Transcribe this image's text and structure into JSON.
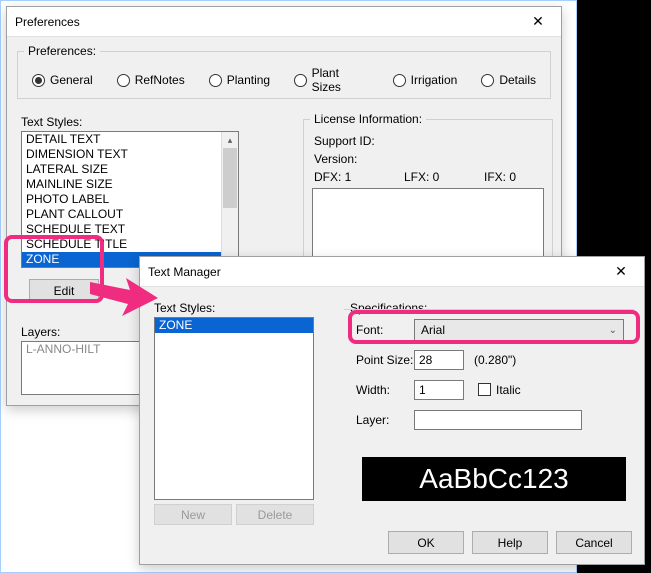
{
  "prefs": {
    "title": "Preferences",
    "group_label": "Preferences:",
    "tabs": {
      "general": "General",
      "refnotes": "RefNotes",
      "planting": "Planting",
      "plant_sizes": "Plant Sizes",
      "irrigation": "Irrigation",
      "details": "Details"
    },
    "text_styles_label": "Text Styles:",
    "text_styles": [
      "DETAIL TEXT",
      "DIMENSION TEXT",
      "LATERAL SIZE",
      "MAINLINE SIZE",
      "PHOTO LABEL",
      "PLANT CALLOUT",
      "SCHEDULE TEXT",
      "SCHEDULE TITLE",
      "ZONE"
    ],
    "edit_label": "Edit",
    "layers_label": "Layers:",
    "layers_value": "L-ANNO-HILT",
    "license": {
      "group_label": "License Information:",
      "support_id_label": "Support ID:",
      "version_label": "Version:",
      "dfx_label": "DFX: 1",
      "lfx_label": "LFX: 0",
      "ifx_label": "IFX: 0"
    }
  },
  "tm": {
    "title": "Text Manager",
    "text_styles_label": "Text Styles:",
    "selected_style": "ZONE",
    "new_label": "New",
    "delete_label": "Delete",
    "spec": {
      "group_label": "Specifications:",
      "font_label": "Font:",
      "font_value": "Arial",
      "point_label": "Point Size:",
      "point_value": "28",
      "point_inches": "(0.280\")",
      "width_label": "Width:",
      "width_value": "1",
      "italic_label": "Italic",
      "layer_label": "Layer:",
      "layer_value": ""
    },
    "preview_text": "AaBbCc123",
    "ok": "OK",
    "help": "Help",
    "cancel": "Cancel"
  }
}
